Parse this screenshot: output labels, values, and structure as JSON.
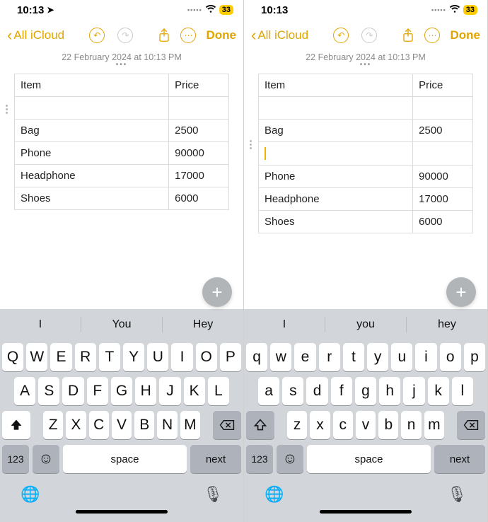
{
  "statusbar": {
    "time": "10:13",
    "battery": "33"
  },
  "toolbar": {
    "back": "All iCloud",
    "done": "Done"
  },
  "timestamp": "22 February 2024 at 10:13 PM",
  "left": {
    "rows": [
      {
        "c0": "Item",
        "c1": "Price"
      },
      {
        "c0": "",
        "c1": ""
      },
      {
        "c0": "Bag",
        "c1": "2500"
      },
      {
        "c0": "Phone",
        "c1": "90000"
      },
      {
        "c0": "Headphone",
        "c1": "17000"
      },
      {
        "c0": "Shoes",
        "c1": "6000"
      }
    ],
    "grip_top": "44",
    "fab_top": "392",
    "suggestions": [
      "I",
      "You",
      "Hey"
    ],
    "kb_case": "upper",
    "kb_rows": {
      "r1": [
        "Q",
        "W",
        "E",
        "R",
        "T",
        "Y",
        "U",
        "I",
        "O",
        "P"
      ],
      "r2": [
        "A",
        "S",
        "D",
        "F",
        "G",
        "H",
        "J",
        "K",
        "L"
      ],
      "r3": [
        "Z",
        "X",
        "C",
        "V",
        "B",
        "N",
        "M"
      ]
    }
  },
  "right": {
    "rows": [
      {
        "c0": "Item",
        "c1": "Price"
      },
      {
        "c0": "",
        "c1": ""
      },
      {
        "c0": "Bag",
        "c1": "2500"
      },
      {
        "c0": "__cursor__",
        "c1": ""
      },
      {
        "c0": "Phone",
        "c1": "90000"
      },
      {
        "c0": "Headphone",
        "c1": "17000"
      },
      {
        "c0": "Shoes",
        "c1": "6000"
      }
    ],
    "grip_top": "94",
    "fab_top": "392",
    "suggestions": [
      "I",
      "you",
      "hey"
    ],
    "kb_case": "lower",
    "kb_rows": {
      "r1": [
        "q",
        "w",
        "e",
        "r",
        "t",
        "y",
        "u",
        "i",
        "o",
        "p"
      ],
      "r2": [
        "a",
        "s",
        "d",
        "f",
        "g",
        "h",
        "j",
        "k",
        "l"
      ],
      "r3": [
        "z",
        "x",
        "c",
        "v",
        "b",
        "n",
        "m"
      ]
    }
  },
  "kb_labels": {
    "space": "space",
    "next": "next",
    "n123": "123"
  }
}
